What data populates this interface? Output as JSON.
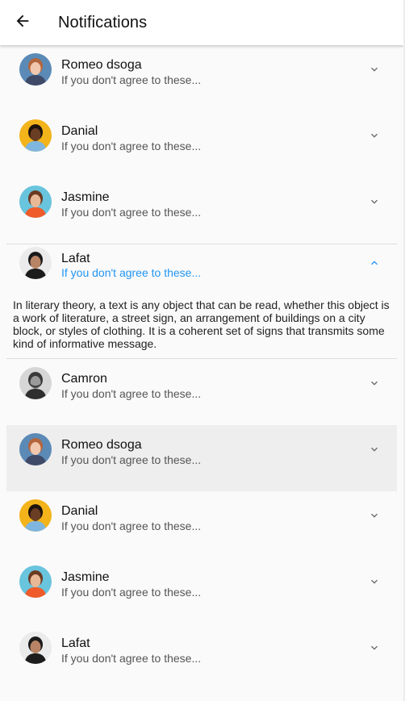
{
  "appbar": {
    "title": "Notifications",
    "back_icon": "arrow-back-icon"
  },
  "accent_color": "#2196f3",
  "items": [
    {
      "name": "Romeo dsoga",
      "subtitle": "If you don't agree to these...",
      "avatar": "woman-redhead",
      "state": "collapsed"
    },
    {
      "name": "Danial",
      "subtitle": "If you don't agree to these...",
      "avatar": "man-yellow-bg",
      "state": "collapsed"
    },
    {
      "name": "Jasmine",
      "subtitle": "If you don't agree to these...",
      "avatar": "woman-orange",
      "state": "collapsed"
    },
    {
      "name": "Lafat",
      "subtitle": "If you don't agree to these...",
      "avatar": "man-dark",
      "state": "expanded",
      "body": "In literary theory, a text is any object that can be read, whether this object is a work of literature, a street sign, an arrangement of buildings on a city block, or styles of clothing. It is a coherent set of signs that transmits some kind of informative message."
    },
    {
      "name": "Camron",
      "subtitle": "If you don't agree to these...",
      "avatar": "man-beard-bw",
      "state": "collapsed"
    },
    {
      "name": "Romeo dsoga",
      "subtitle": "If you don't agree to these...",
      "avatar": "woman-redhead",
      "state": "highlighted"
    },
    {
      "name": "Danial",
      "subtitle": "If you don't agree to these...",
      "avatar": "man-yellow-bg",
      "state": "collapsed"
    },
    {
      "name": "Jasmine",
      "subtitle": "If you don't agree to these...",
      "avatar": "woman-orange",
      "state": "collapsed"
    },
    {
      "name": "Lafat",
      "subtitle": "If you don't agree to these...",
      "avatar": "man-dark",
      "state": "collapsed"
    }
  ]
}
